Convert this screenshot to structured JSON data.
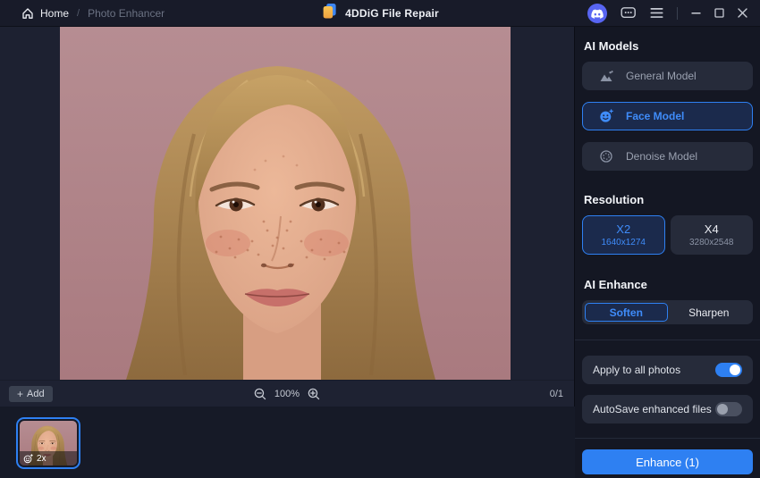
{
  "topbar": {
    "breadcrumb": {
      "home": "Home",
      "separator": "/",
      "current": "Photo Enhancer"
    },
    "app_title": "4DDiG File Repair"
  },
  "sidebar": {
    "ai_models": {
      "heading": "AI Models",
      "items": [
        {
          "label": "General Model",
          "icon": "mountain-icon",
          "selected": false
        },
        {
          "label": "Face Model",
          "icon": "smiley-face-icon",
          "selected": true
        },
        {
          "label": "Denoise Model",
          "icon": "denoise-dots-icon",
          "selected": false
        }
      ]
    },
    "resolution": {
      "heading": "Resolution",
      "options": [
        {
          "label": "X2",
          "sub": "1640x1274",
          "selected": true
        },
        {
          "label": "X4",
          "sub": "3280x2548",
          "selected": false
        }
      ]
    },
    "ai_enhance": {
      "heading": "AI Enhance",
      "options": [
        {
          "label": "Soften",
          "selected": true
        },
        {
          "label": "Sharpen",
          "selected": false
        }
      ]
    },
    "settings": [
      {
        "label": "Apply to all photos",
        "on": true
      },
      {
        "label": "AutoSave enhanced files",
        "on": false
      }
    ],
    "enhance_button": "Enhance (1)"
  },
  "toolbar": {
    "add_label": "Add",
    "zoom_level": "100%",
    "counter": "0/1"
  },
  "thumbnail": {
    "badge": "2x"
  },
  "colors": {
    "accent": "#2e80f2",
    "accent_text": "#3f8cfa",
    "discord": "#5865f2",
    "photo_background": "#b08186"
  }
}
